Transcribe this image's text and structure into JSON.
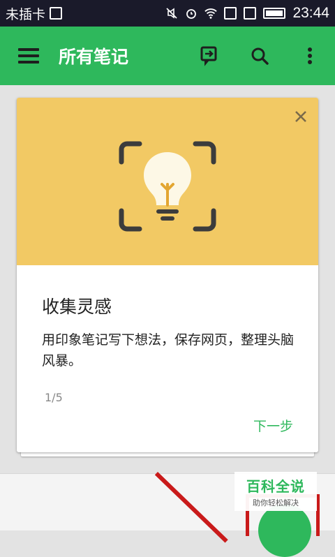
{
  "status_bar": {
    "carrier": "未插卡",
    "time": "23:44",
    "icons": [
      "image-icon",
      "mute-icon",
      "alarm-icon",
      "wifi-icon",
      "sim1-icon",
      "sim2-icon",
      "battery-icon"
    ]
  },
  "app_bar": {
    "title": "所有笔记",
    "icons": [
      "menu-icon",
      "sync-icon",
      "search-icon",
      "more-icon"
    ],
    "background": "#2eb85c"
  },
  "onboarding_card": {
    "heading": "收集灵感",
    "body": "用印象笔记写下想法，保存网页，整理头脑风暴。",
    "pager": "1/5",
    "next_label": "下一步",
    "illustration_bg": "#f2c964",
    "illustration_icon": "lightbulb-icon"
  },
  "watermark": {
    "main": "百科全说",
    "sub": "助你轻松解决"
  },
  "colors": {
    "accent": "#2eb85c",
    "annotation_red": "#c91a1a"
  }
}
